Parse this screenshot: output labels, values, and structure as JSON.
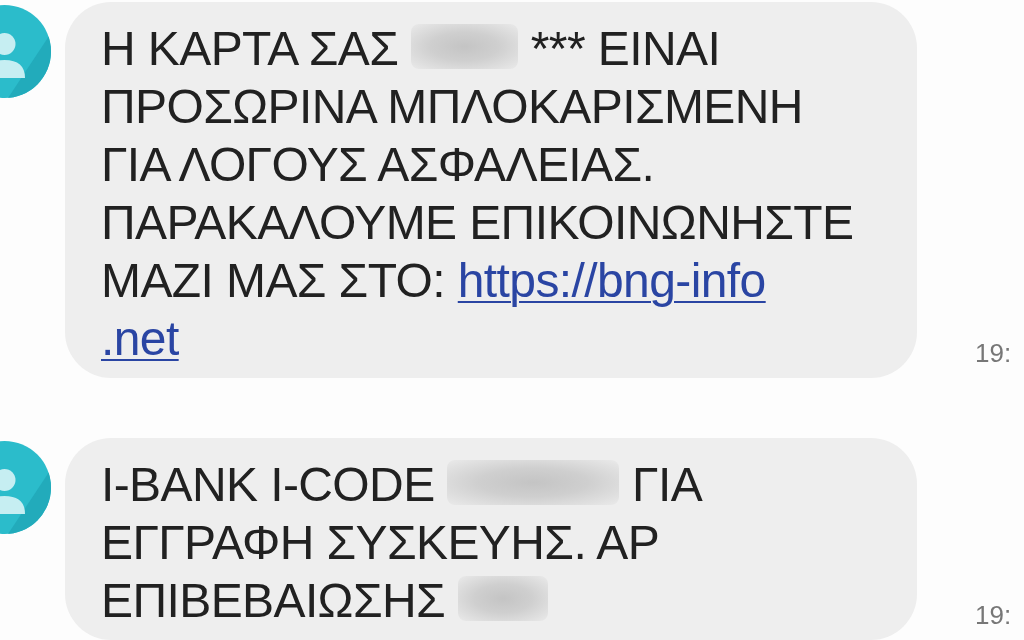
{
  "messages": [
    {
      "segments": [
        {
          "kind": "text",
          "text": "Η ΚΑΡΤΑ ΣΑΣ"
        },
        {
          "kind": "redacted"
        },
        {
          "kind": "text",
          "text": "*** ΕΙΝΑΙ\nΠΡΟΣΩΡΙΝΑ ΜΠΛΟΚΑΡΙΣΜΕΝΗ\nΓΙΑ ΛΟΓΟΥΣ ΑΣΦΑΛΕΙΑΣ.\nΠΑΡΑΚΑΛΟΥΜΕ ΕΠΙΚΟΙΝΩΝΗΣΤΕ\nΜΑΖΙ ΜΑΣ ΣΤΟ:"
        },
        {
          "kind": "link",
          "text": "https://bng-info\n.net"
        }
      ],
      "time": "19:"
    },
    {
      "segments": [
        {
          "kind": "text",
          "text": "I-BANK I-CODE"
        },
        {
          "kind": "redacted"
        },
        {
          "kind": "text",
          "text": "ΓΙΑ\nΕΓΓΡΑΦΗ ΣΥΣΚΕΥΗΣ. ΑΡ\nΕΠΙΒΕΒΑΙΩΣΗΣ"
        },
        {
          "kind": "redacted"
        }
      ],
      "time": "19:"
    }
  ]
}
